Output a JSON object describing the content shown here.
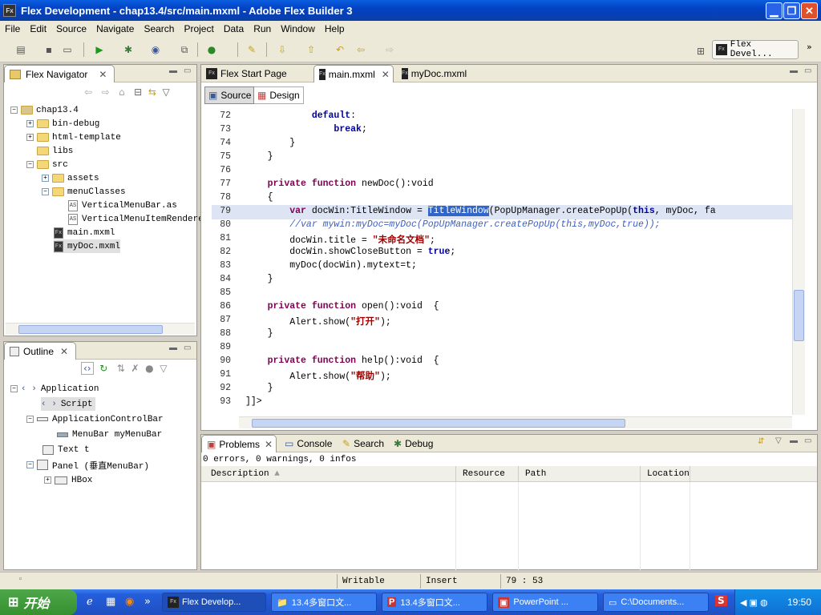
{
  "window": {
    "title": "Flex Development - chap13.4/src/main.mxml - Adobe Flex Builder 3",
    "app_icon": "Fx"
  },
  "menu": [
    "File",
    "Edit",
    "Source",
    "Navigate",
    "Search",
    "Project",
    "Data",
    "Run",
    "Window",
    "Help"
  ],
  "perspective": {
    "label": "Flex Devel..."
  },
  "navigator": {
    "title": "Flex Navigator",
    "tree": [
      {
        "label": "chap13.4",
        "type": "project",
        "toggle": "−"
      },
      {
        "label": "bin-debug",
        "type": "folder",
        "toggle": "+"
      },
      {
        "label": "html-template",
        "type": "folder",
        "toggle": "+"
      },
      {
        "label": "libs",
        "type": "folder",
        "toggle": ""
      },
      {
        "label": "src",
        "type": "folder",
        "toggle": "−"
      },
      {
        "label": "assets",
        "type": "folder",
        "toggle": "+"
      },
      {
        "label": "menuClasses",
        "type": "folder",
        "toggle": "−"
      },
      {
        "label": "VerticalMenuBar.as",
        "type": "as-file",
        "toggle": ""
      },
      {
        "label": "VerticalMenuItemRendere",
        "type": "as-file",
        "toggle": ""
      },
      {
        "label": "main.mxml",
        "type": "mxml-file",
        "toggle": ""
      },
      {
        "label": "myDoc.mxml",
        "type": "mxml-file",
        "toggle": ""
      }
    ]
  },
  "outline": {
    "title": "Outline",
    "tree": [
      {
        "label": "Application",
        "toggle": "−"
      },
      {
        "label": "Script",
        "toggle": ""
      },
      {
        "label": "ApplicationControlBar",
        "toggle": "−"
      },
      {
        "label": "MenuBar myMenuBar",
        "toggle": ""
      },
      {
        "label": "Text t",
        "toggle": ""
      },
      {
        "label": "Panel (垂直MenuBar)",
        "toggle": "−"
      },
      {
        "label": "HBox",
        "toggle": "+"
      }
    ]
  },
  "editor_tabs": [
    "Flex Start Page",
    "main.mxml",
    "myDoc.mxml"
  ],
  "mode_tabs": {
    "source": "Source",
    "design": "Design"
  },
  "code_lines": [
    {
      "n": "72",
      "t": "            default:"
    },
    {
      "n": "73",
      "t": "                break;"
    },
    {
      "n": "74",
      "t": "        }"
    },
    {
      "n": "75",
      "t": "    }"
    },
    {
      "n": "76",
      "t": ""
    },
    {
      "n": "77",
      "t": "    private function newDoc():void"
    },
    {
      "n": "78",
      "t": "    {"
    },
    {
      "n": "79",
      "t": "        var docWin:TitleWindow = TitleWindow(PopUpManager.createPopUp(this, myDoc, fa"
    },
    {
      "n": "80",
      "t": "        //var mywin:myDoc=myDoc(PopUpManager.createPopUp(this,myDoc,true));"
    },
    {
      "n": "81",
      "t": "        docWin.title = \"未命名文档\";"
    },
    {
      "n": "82",
      "t": "        docWin.showCloseButton = true;"
    },
    {
      "n": "83",
      "t": "        myDoc(docWin).mytext=t;"
    },
    {
      "n": "84",
      "t": "    }"
    },
    {
      "n": "85",
      "t": ""
    },
    {
      "n": "86",
      "t": "    private function open():void  {"
    },
    {
      "n": "87",
      "t": "        Alert.show(\"打开\");"
    },
    {
      "n": "88",
      "t": "    }"
    },
    {
      "n": "89",
      "t": ""
    },
    {
      "n": "90",
      "t": "    private function help():void  {"
    },
    {
      "n": "91",
      "t": "        Alert.show(\"帮助\");"
    },
    {
      "n": "92",
      "t": "    }"
    },
    {
      "n": "93",
      "t": "]]>"
    }
  ],
  "bottom_tabs": [
    "Problems",
    "Console",
    "Search",
    "Debug"
  ],
  "problems": {
    "summary": "0 errors, 0 warnings, 0 infos",
    "columns": [
      "Description",
      "Resource",
      "Path",
      "Location"
    ]
  },
  "status": {
    "writable": "Writable",
    "insert": "Insert",
    "position": "79 : 53"
  },
  "taskbar": {
    "start": "开始",
    "tasks": [
      "Flex Develop...",
      "13.4多窗口文...",
      "13.4多窗口文...",
      "PowerPoint ...",
      "C:\\Documents..."
    ],
    "clock": "19:50"
  },
  "colors": {
    "titlebar": "#0a5fe0",
    "selection": "#3166c8",
    "keyword": "#0000a0",
    "string": "#a00000",
    "comment": "#3f5fbf"
  }
}
